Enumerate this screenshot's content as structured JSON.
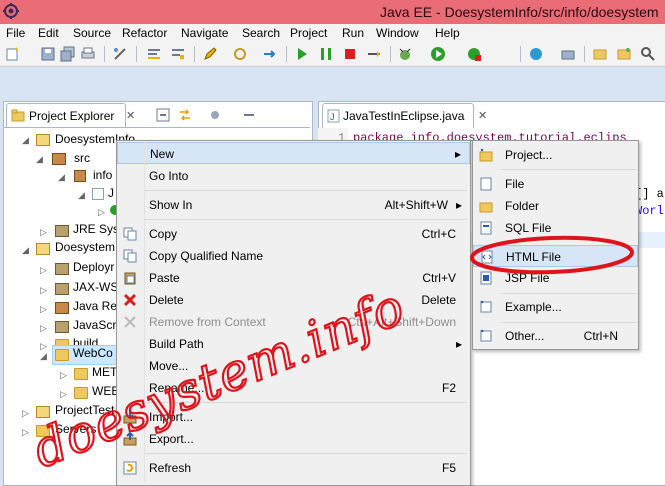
{
  "window": {
    "title": "Java EE - DoesystemInfo/src/info/doesystem"
  },
  "menubar": [
    "File",
    "Edit",
    "Source",
    "Refactor",
    "Navigate",
    "Search",
    "Project",
    "Run",
    "Window",
    "Help"
  ],
  "project_explorer": {
    "tab_label": "Project Explorer",
    "close_glyph": "✕",
    "tree": [
      {
        "label": "DoesystemInfo",
        "expander": "◢"
      },
      {
        "label": "src",
        "expander": "◢"
      },
      {
        "label": "info",
        "expander": "◢"
      },
      {
        "label": "J",
        "expander": "◢"
      },
      {
        "label": "",
        "expander": "▷"
      },
      {
        "label": "JRE Syst",
        "expander": "▷"
      },
      {
        "label": "Doesystem",
        "expander": "◢"
      },
      {
        "label": "Deployr",
        "expander": "▷"
      },
      {
        "label": "JAX-WS",
        "expander": "▷"
      },
      {
        "label": "Java Res",
        "expander": "▷"
      },
      {
        "label": "JavaScri",
        "expander": "▷"
      },
      {
        "label": "build",
        "expander": "▷"
      },
      {
        "label": "WebCo",
        "expander": "◢"
      },
      {
        "label": "MET",
        "expander": "▷"
      },
      {
        "label": "WEB",
        "expander": "▷"
      },
      {
        "label": "ProjectTest",
        "expander": "▷"
      },
      {
        "label": "Servers",
        "expander": "▷"
      }
    ]
  },
  "editor": {
    "tab_label": "JavaTestInEclipse.java",
    "close_glyph": "✕",
    "line_number": "1",
    "code_line_1": "package info.doesystem.tutorial.eclips",
    "code_frag_a": "[] a",
    "code_frag_b": "Worl"
  },
  "context_menu": {
    "submenu_arrow": "▸",
    "items": [
      {
        "label": "New",
        "shortcut": "",
        "submenu": true
      },
      {
        "label": "Go Into",
        "shortcut": ""
      },
      {
        "label": "Show In",
        "shortcut": "Alt+Shift+W",
        "submenu": true
      },
      {
        "label": "Copy",
        "shortcut": "Ctrl+C"
      },
      {
        "label": "Copy Qualified Name",
        "shortcut": ""
      },
      {
        "label": "Paste",
        "shortcut": "Ctrl+V"
      },
      {
        "label": "Delete",
        "shortcut": "Delete"
      },
      {
        "label": "Remove from Context",
        "shortcut": "Ctrl+Alt+Shift+Down",
        "disabled": true
      },
      {
        "label": "Build Path",
        "shortcut": "",
        "submenu": true
      },
      {
        "label": "Move...",
        "shortcut": ""
      },
      {
        "label": "Rename...",
        "shortcut": "F2"
      },
      {
        "label": "Import...",
        "shortcut": ""
      },
      {
        "label": "Export...",
        "shortcut": ""
      },
      {
        "label": "Refresh",
        "shortcut": "F5"
      }
    ]
  },
  "new_submenu": {
    "items": [
      {
        "label": "Project...",
        "shortcut": ""
      },
      {
        "label": "File",
        "shortcut": ""
      },
      {
        "label": "Folder",
        "shortcut": ""
      },
      {
        "label": "SQL File",
        "shortcut": ""
      },
      {
        "label": "HTML File",
        "shortcut": ""
      },
      {
        "label": "JSP File",
        "shortcut": ""
      },
      {
        "label": "Example...",
        "shortcut": ""
      },
      {
        "label": "Other...",
        "shortcut": "Ctrl+N"
      }
    ]
  },
  "watermark": {
    "text": "doesystem.info",
    "color": "#e0121b"
  },
  "colors": {
    "title_bar": "#e96c76",
    "highlight_circle": "#e0121b",
    "menu_hover": "#d6e6f7"
  }
}
